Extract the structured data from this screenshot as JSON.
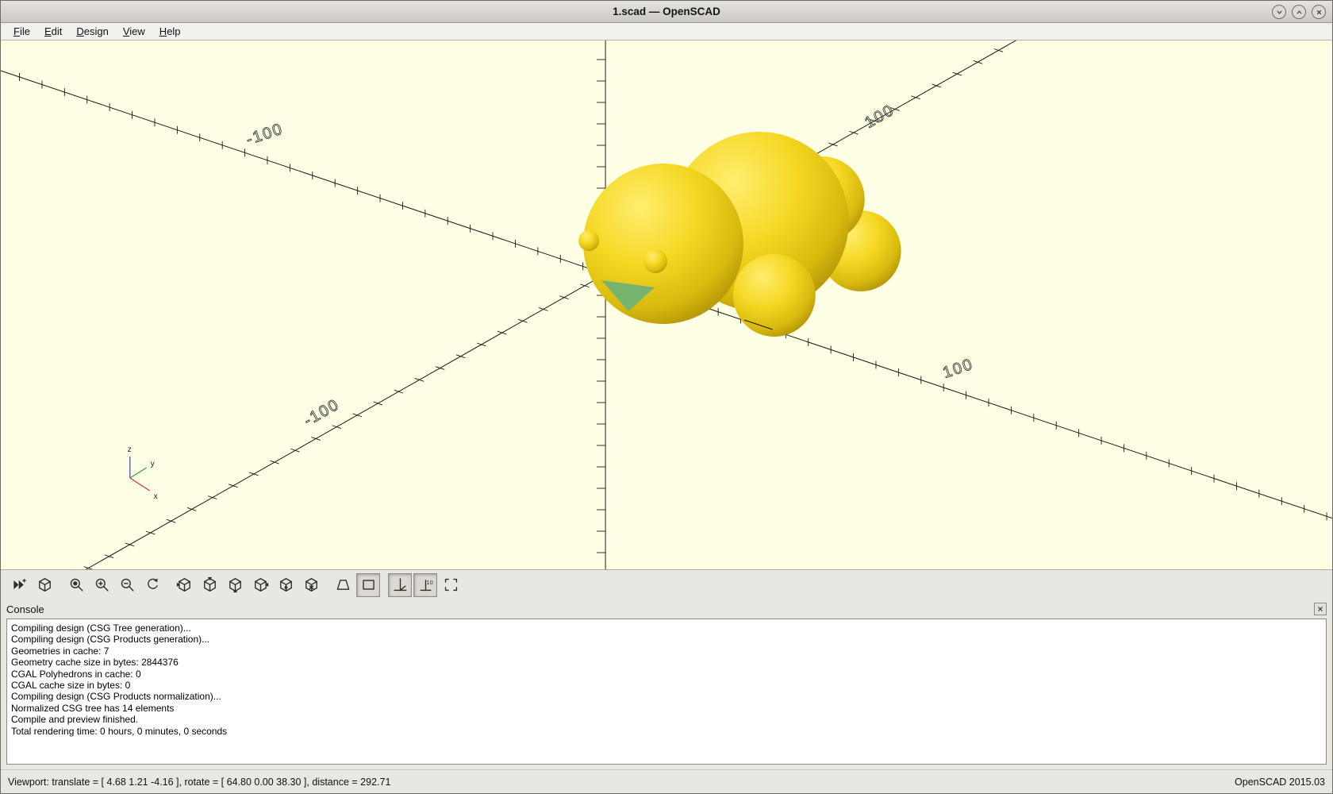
{
  "window": {
    "title": "1.scad — OpenSCAD",
    "icons": {
      "shade": "chevron-down",
      "unshade": "chevron-up",
      "close": "x"
    }
  },
  "menu": {
    "items": [
      {
        "label": "File"
      },
      {
        "label": "Edit"
      },
      {
        "label": "Design"
      },
      {
        "label": "View"
      },
      {
        "label": "Help"
      }
    ]
  },
  "viewport": {
    "background": "#FFFFE5",
    "axis_color": "#1A1A1A",
    "axis_labels": {
      "neg": "-100",
      "pos": "100"
    },
    "model": {
      "highlight": "#FFEE70",
      "base": "#F5D722",
      "mid": "#D8B90E",
      "shadow": "#AD8E06",
      "mouth": "#74B46E"
    },
    "orientation_axes": {
      "x_label": "x",
      "y_label": "y",
      "z_label": "z",
      "x_color": "#CC3333",
      "y_color": "#33A033",
      "z_color": "#3344CC"
    }
  },
  "toolbar": {
    "buttons": [
      {
        "name": "preview",
        "icon": "preview-icon",
        "pressed": false
      },
      {
        "name": "render",
        "icon": "render-icon",
        "pressed": false
      },
      {
        "name": "zoom-all",
        "icon": "zoom-all-icon",
        "pressed": false
      },
      {
        "name": "zoom-in",
        "icon": "zoom-in-icon",
        "pressed": false
      },
      {
        "name": "zoom-out",
        "icon": "zoom-out-icon",
        "pressed": false
      },
      {
        "name": "reset-view",
        "icon": "reset-view-icon",
        "pressed": false
      },
      {
        "name": "view-right",
        "icon": "view-right-icon",
        "pressed": false
      },
      {
        "name": "view-top",
        "icon": "view-top-icon",
        "pressed": false
      },
      {
        "name": "view-bottom",
        "icon": "view-bottom-icon",
        "pressed": false
      },
      {
        "name": "view-left",
        "icon": "view-left-icon",
        "pressed": false
      },
      {
        "name": "view-front",
        "icon": "view-front-icon",
        "pressed": false
      },
      {
        "name": "view-back",
        "icon": "view-back-icon",
        "pressed": false
      },
      {
        "name": "view-perspective",
        "icon": "view-perspective-icon",
        "pressed": false
      },
      {
        "name": "view-orthogonal",
        "icon": "view-orthogonal-icon",
        "pressed": true
      },
      {
        "name": "show-axes",
        "icon": "show-axes-icon",
        "pressed": true
      },
      {
        "name": "show-scale-markers",
        "icon": "show-scale-markers-icon",
        "pressed": true
      },
      {
        "name": "show-crosshairs",
        "icon": "show-crosshairs-icon",
        "pressed": false
      }
    ]
  },
  "console": {
    "title": "Console",
    "lines": [
      "Compiling design (CSG Tree generation)...",
      "Compiling design (CSG Products generation)...",
      "Geometries in cache: 7",
      "Geometry cache size in bytes: 2844376",
      "CGAL Polyhedrons in cache: 0",
      "CGAL cache size in bytes: 0",
      "Compiling design (CSG Products normalization)...",
      "Normalized CSG tree has 14 elements",
      "Compile and preview finished.",
      "Total rendering time: 0 hours, 0 minutes, 0 seconds"
    ]
  },
  "statusbar": {
    "left": "Viewport: translate = [ 4.68 1.21 -4.16 ], rotate = [ 64.80 0.00 38.30 ], distance = 292.71",
    "right": "OpenSCAD 2015.03"
  }
}
